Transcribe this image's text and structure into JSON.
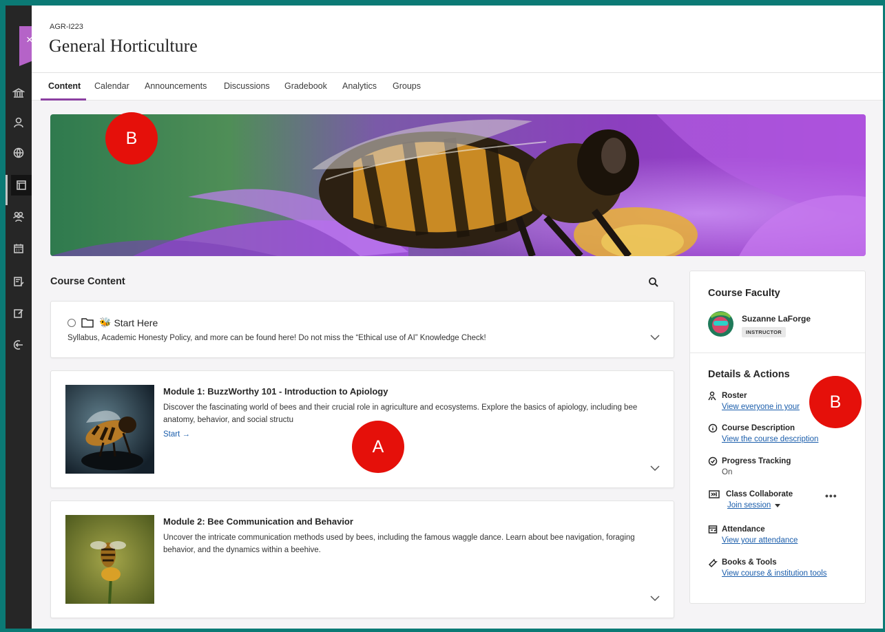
{
  "header": {
    "course_code": "AGR-I223",
    "course_title": "General Horticulture"
  },
  "tabs": [
    {
      "label": "Content",
      "active": true
    },
    {
      "label": "Calendar"
    },
    {
      "label": "Announcements"
    },
    {
      "label": "Discussions"
    },
    {
      "label": "Gradebook"
    },
    {
      "label": "Analytics"
    },
    {
      "label": "Groups"
    }
  ],
  "rail": {
    "close_glyph": "×",
    "icons": [
      "institution-icon",
      "profile-icon",
      "globe-icon",
      "courses-icon",
      "groups-icon",
      "calendar-icon",
      "grades-icon",
      "edit-icon",
      "logout-icon"
    ]
  },
  "markers": {
    "a": "A",
    "b_banner": "B",
    "b_panel": "B"
  },
  "content": {
    "section_title": "Course Content",
    "start_here": {
      "title": "Start Here",
      "emoji": "🐝",
      "description": "Syllabus, Academic Honesty Policy, and more can be found here! Do not miss the “Ethical use of AI” Knowledge Check!"
    },
    "modules": [
      {
        "title": "Module 1: BuzzWorthy 101 - Introduction to Apiology",
        "description": "Discover the fascinating world of bees and their crucial role in agriculture and ecosystems. Explore the basics of apiology, including bee anatomy, behavior, and social structu",
        "start_label": "Start →"
      },
      {
        "title": "Module 2: Bee Communication and Behavior",
        "description": "Uncover the intricate communication methods used by bees, including the famous waggle dance. Learn about bee navigation, foraging behavior, and the dynamics within a beehive."
      }
    ]
  },
  "panel": {
    "faculty_heading": "Course Faculty",
    "faculty_name": "Suzanne LaForge",
    "faculty_role": "INSTRUCTOR",
    "details_heading": "Details & Actions",
    "roster": {
      "label": "Roster",
      "link": "View everyone in your"
    },
    "course_description": {
      "label": "Course Description",
      "link": "View the course description"
    },
    "progress_tracking": {
      "label": "Progress Tracking",
      "value": "On"
    },
    "collaborate": {
      "label": "Class Collaborate",
      "link": "Join session",
      "more": "•••"
    },
    "attendance": {
      "label": "Attendance",
      "link": "View your attendance"
    },
    "books_tools": {
      "label": "Books & Tools",
      "link": "View course & institution tools"
    }
  },
  "colors": {
    "accent": "#8b3fa1",
    "link": "#1a5dab",
    "marker": "#e5100a",
    "frame": "#0b7a75"
  }
}
